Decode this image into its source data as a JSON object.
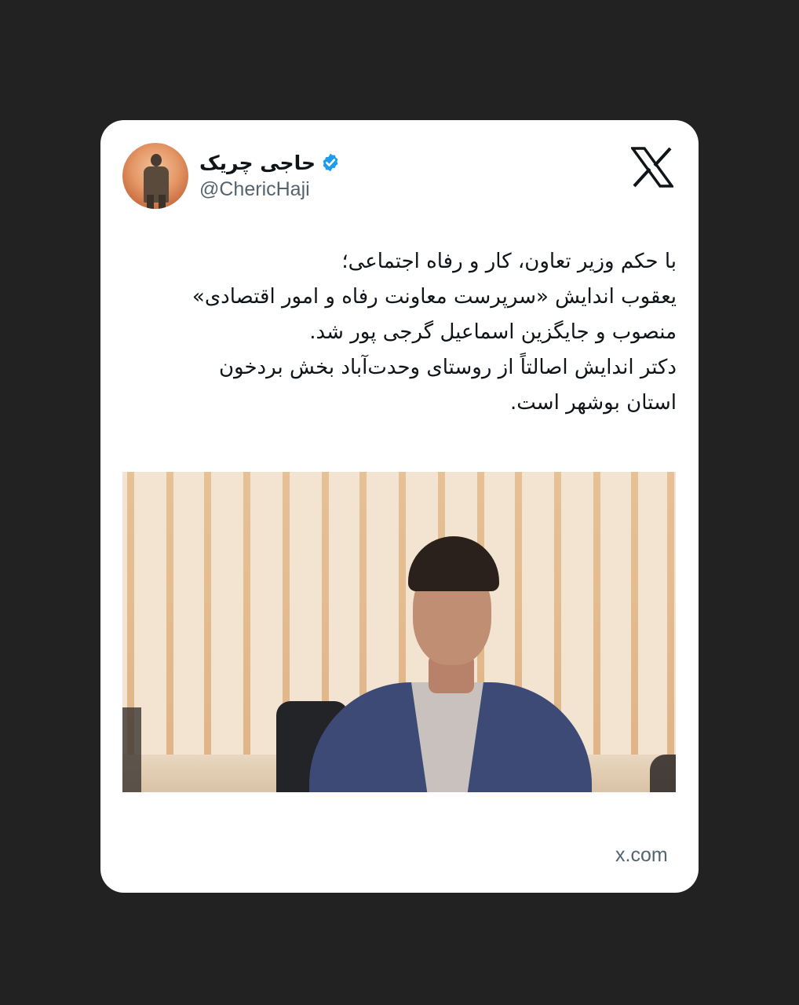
{
  "tweet": {
    "display_name": "حاجی چریک",
    "handle": "@ChericHaji",
    "verified": true,
    "text_lines": [
      "با حکم وزیر تعاون، کار و رفاه اجتماعی؛",
      "یعقوب اندایش «سرپرست معاونت رفاه و امور اقتصادی»",
      "منصوب و جایگزین اسماعیل گرجی پور شد.",
      "دکتر اندایش اصالتاً از روستای وحدت‌آباد بخش بردخون",
      "استان بوشهر است."
    ],
    "domain": "x.com"
  },
  "icons": {
    "logo": "x-logo-icon",
    "verified": "verified-badge-icon"
  },
  "colors": {
    "background": "#222222",
    "card": "#ffffff",
    "text": "#0f1419",
    "muted": "#536471",
    "verified": "#1d9bf0"
  }
}
